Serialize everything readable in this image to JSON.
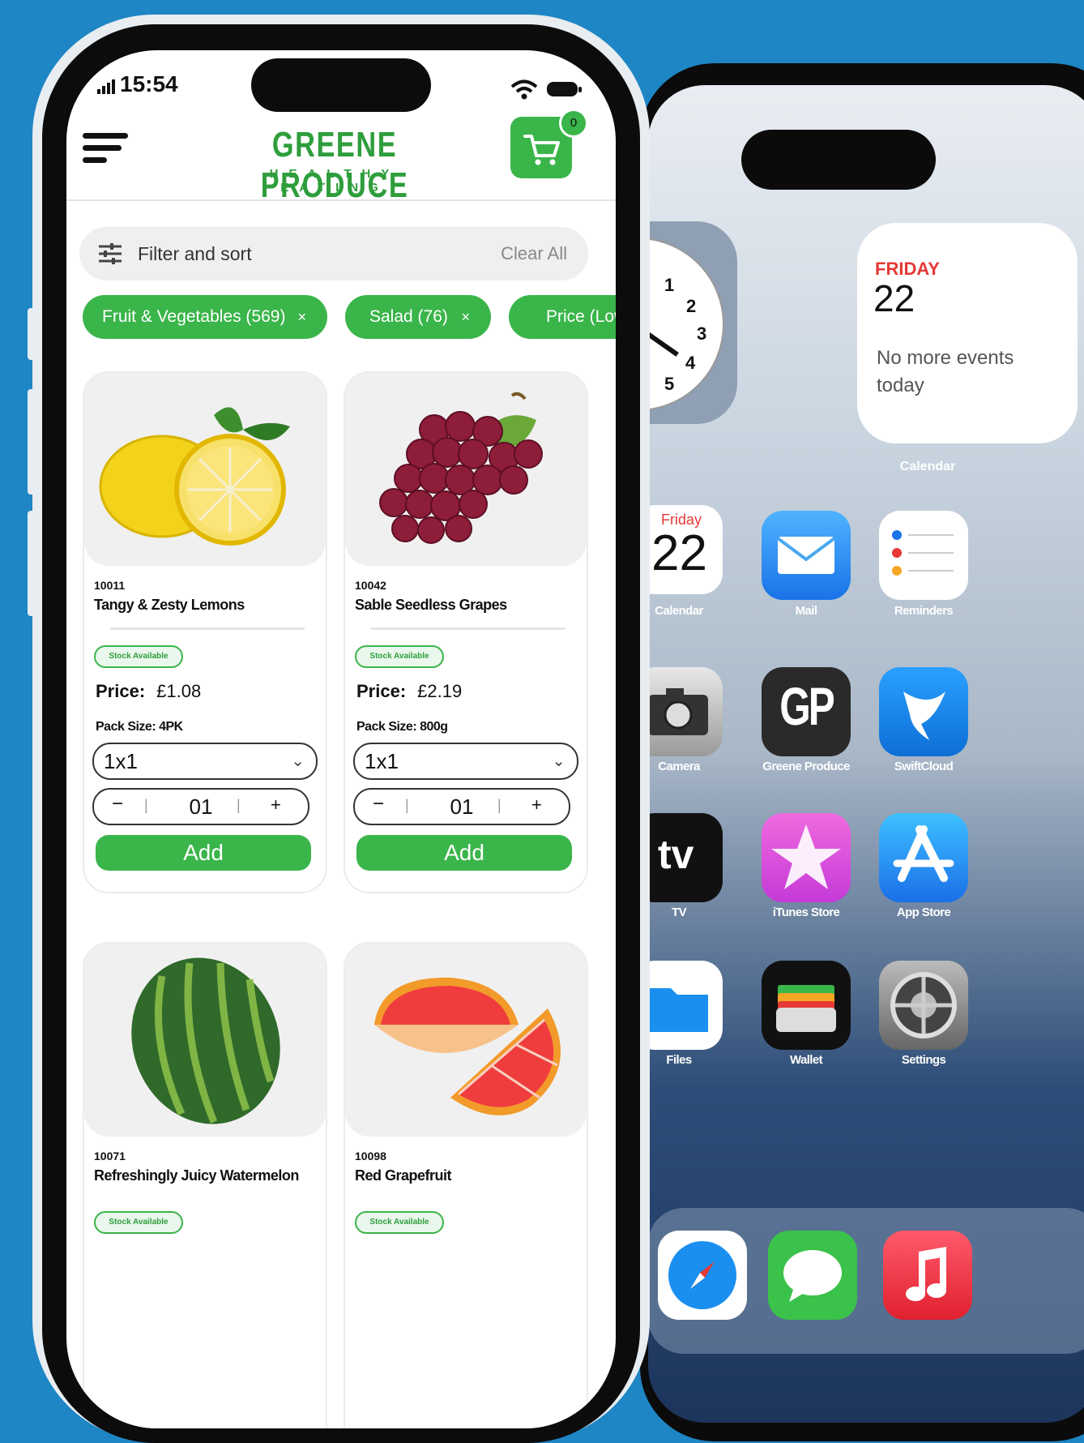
{
  "front_phone": {
    "status_bar": {
      "time": "15:54"
    },
    "header": {
      "logo_main": "GREENE PRODUCE",
      "logo_sub": "HEALTHY EATING",
      "cart_count": "0"
    },
    "filter_bar": {
      "label": "Filter and sort",
      "clear_label": "Clear All"
    },
    "chips": [
      {
        "label": "Fruit & Vegetables (569)",
        "close": "×"
      },
      {
        "label": "Salad (76)",
        "close": "×"
      },
      {
        "label": "Price (Low"
      }
    ],
    "products": [
      {
        "code": "10011",
        "name": "Tangy & Zesty Lemons",
        "stock": "Stock Available",
        "price_label": "Price:",
        "price": "£1.08",
        "pack": "Pack Size: 4PK",
        "select": "1x1",
        "qty": "01",
        "add": "Add"
      },
      {
        "code": "10042",
        "name": "Sable Seedless Grapes",
        "stock": "Stock Available",
        "price_label": "Price:",
        "price": "£2.19",
        "pack": "Pack Size: 800g",
        "select": "1x1",
        "qty": "01",
        "add": "Add"
      },
      {
        "code": "10071",
        "name": "Refreshingly Juicy Watermelon",
        "stock": "Stock Available"
      },
      {
        "code": "10098",
        "name": "Red Grapefruit",
        "stock": "Stock Available"
      }
    ]
  },
  "back_phone": {
    "calendar_widget": {
      "day": "FRIDAY",
      "date": "22",
      "message": "No more events today",
      "label": "Calendar"
    },
    "clock_numbers": [
      "1",
      "2",
      "3",
      "4",
      "5"
    ],
    "apps": [
      {
        "label": "Calendar",
        "day": "Friday",
        "date": "22"
      },
      {
        "label": "Mail"
      },
      {
        "label": "Reminders"
      },
      {
        "label": "Camera"
      },
      {
        "label": "Greene Produce",
        "glyph": "GP"
      },
      {
        "label": "SwiftCloud"
      },
      {
        "label": "TV",
        "glyph": "tv"
      },
      {
        "label": "iTunes Store"
      },
      {
        "label": "App Store"
      },
      {
        "label": "Files"
      },
      {
        "label": "Wallet"
      },
      {
        "label": "Settings"
      }
    ],
    "dock": [
      "Safari",
      "Messages",
      "Music"
    ]
  },
  "colors": {
    "brand_green": "#3ab54a",
    "background": "#1e86c4"
  }
}
